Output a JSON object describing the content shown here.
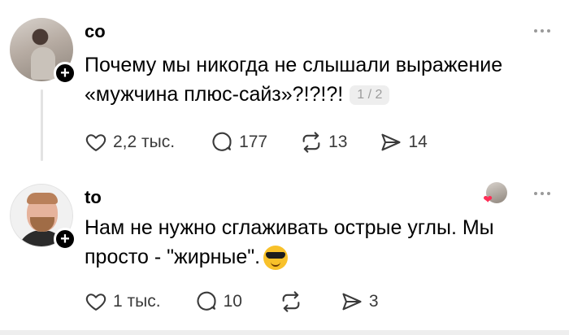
{
  "posts": [
    {
      "username": "co",
      "text": "Почему мы никогда не слышали выражение «мужчина плюс-сайз»?!?!?!",
      "page_indicator": "1 / 2",
      "likes": "2,2 тыс.",
      "replies": "177",
      "reposts": "13",
      "shares": "14"
    },
    {
      "username": "to",
      "text": "Нам не нужно сглаживать острые углы. Мы просто - \"жирные\".",
      "emoji": "smiling-face-with-sunglasses",
      "likes": "1 тыс.",
      "replies": "10",
      "reposts": "",
      "shares": "3"
    }
  ],
  "icons": [
    "more-icon",
    "plus-icon",
    "heart-icon",
    "comment-icon",
    "repost-icon",
    "share-icon"
  ],
  "colors": {
    "text": "#000000",
    "muted": "#9c9c9c",
    "icon": "#3a3a3a",
    "divider": "#e3e3e3",
    "heart_badge": "#ff2d55"
  }
}
